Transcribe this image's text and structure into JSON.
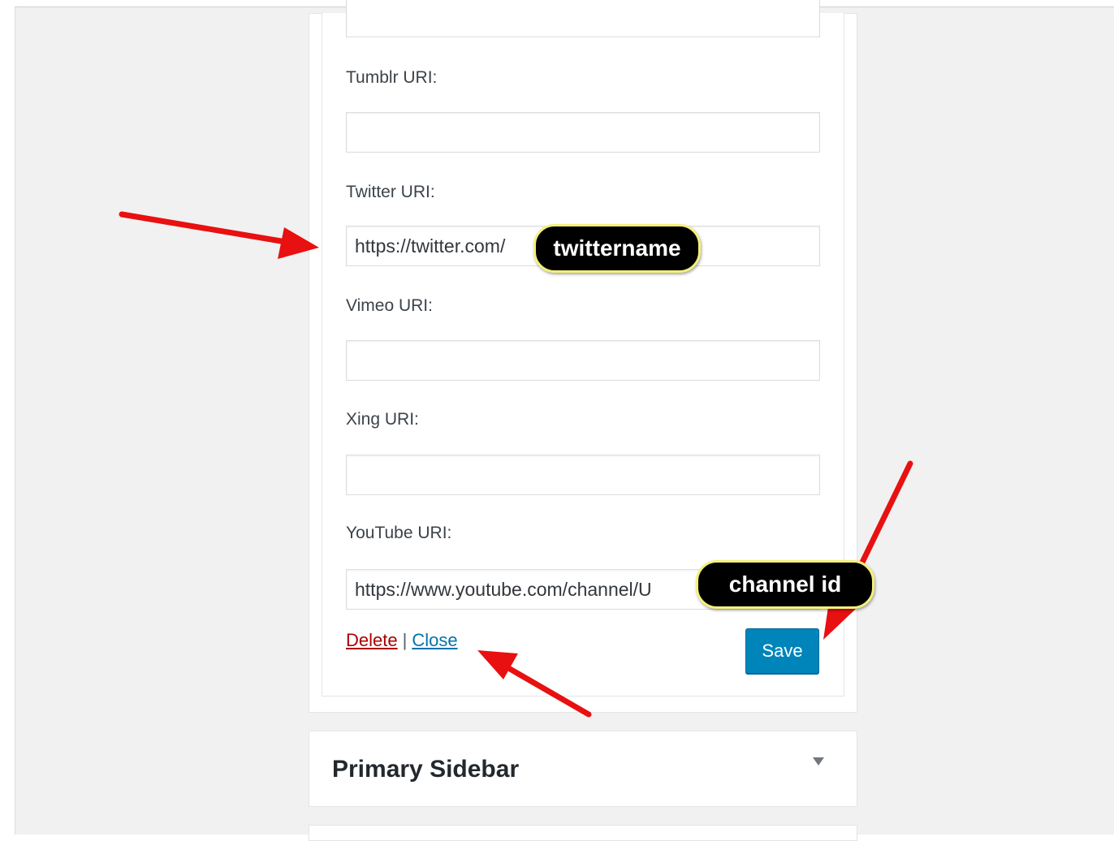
{
  "fields": [
    {
      "label": "",
      "value": "",
      "placeholder": ""
    },
    {
      "label": "Tumblr URI:",
      "value": "",
      "placeholder": ""
    },
    {
      "label": "Twitter URI:",
      "value": "https://twitter.com/",
      "placeholder": ""
    },
    {
      "label": "Vimeo URI:",
      "value": "",
      "placeholder": ""
    },
    {
      "label": "Xing URI:",
      "value": "",
      "placeholder": ""
    },
    {
      "label": "YouTube URI:",
      "value": "https://www.youtube.com/channel/U",
      "placeholder": ""
    }
  ],
  "actions": {
    "delete_label": "Delete",
    "separator": "|",
    "close_label": "Close",
    "save_label": "Save"
  },
  "sidebar": {
    "title": "Primary Sidebar",
    "toggle_icon": "caret-down-icon"
  },
  "callouts": {
    "twitter": "twittername",
    "youtube": "channel id"
  },
  "colors": {
    "accent": "#0085ba",
    "delete": "#aa0000",
    "link": "#0073aa",
    "annotation_arrow": "#e81010",
    "callout_border": "#f4f07a"
  }
}
